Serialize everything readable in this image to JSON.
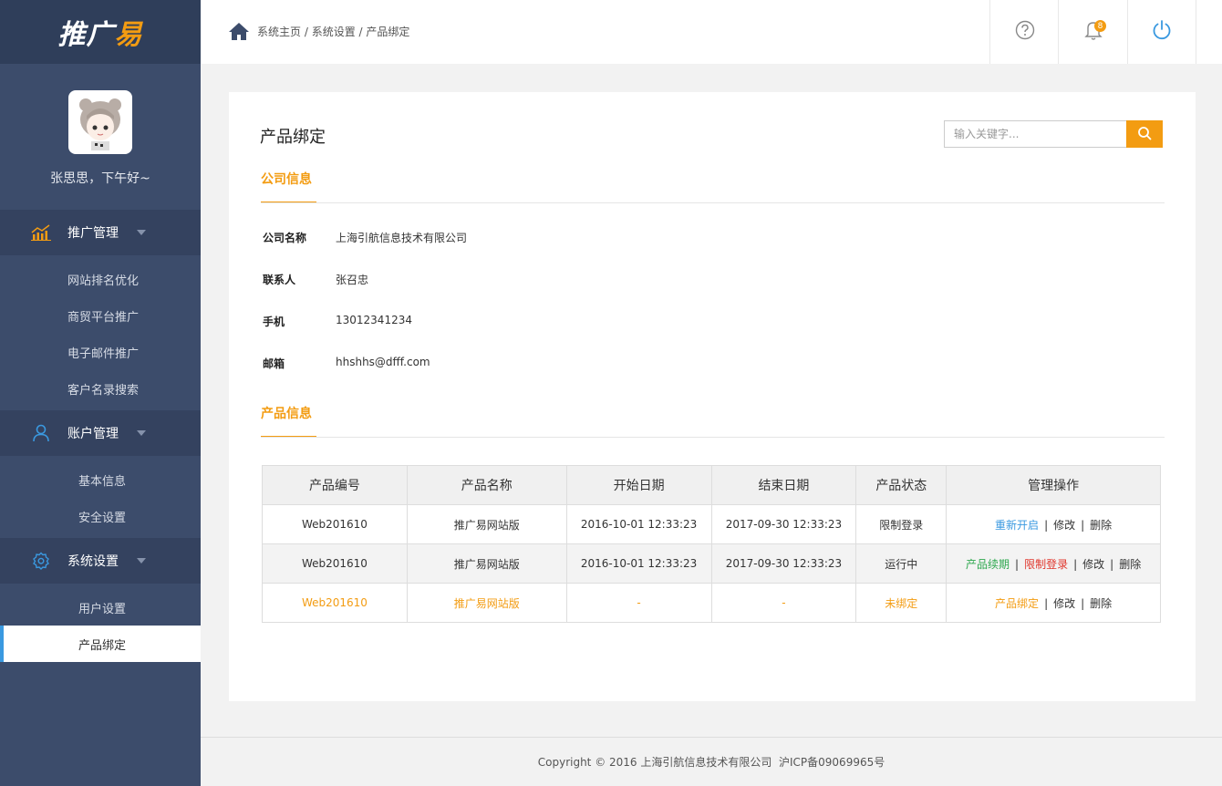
{
  "logo": {
    "text_main": "推广",
    "text_accent": "易"
  },
  "profile": {
    "greeting": "张思思，下午好~"
  },
  "menu": [
    {
      "label": "推广管理",
      "icon": "chart-icon",
      "items": [
        "网站排名优化",
        "商贸平台推广",
        "电子邮件推广",
        "客户名录搜索"
      ]
    },
    {
      "label": "账户管理",
      "icon": "user-icon",
      "items": [
        "基本信息",
        "安全设置"
      ]
    },
    {
      "label": "系统设置",
      "icon": "gear-icon",
      "items": [
        "用户设置",
        "产品绑定"
      ]
    }
  ],
  "breadcrumb": {
    "home": "系统主页",
    "sep1": " / ",
    "level2": "系统设置",
    "sep2": " / ",
    "current": "产品绑定"
  },
  "header": {
    "notification_count": "8"
  },
  "page": {
    "title": "产品绑定",
    "search_placeholder": "输入关键字..."
  },
  "company": {
    "tab": "公司信息",
    "fields": [
      {
        "label": "公司名称",
        "value": "上海引航信息技术有限公司"
      },
      {
        "label": "联系人",
        "value": "张召忠"
      },
      {
        "label": "手机",
        "value": "13012341234"
      },
      {
        "label": "邮箱",
        "value": "hhshhs@dfff.com"
      }
    ]
  },
  "products": {
    "tab": "产品信息",
    "headers": [
      "产品编号",
      "产品名称",
      "开始日期",
      "结束日期",
      "产品状态",
      "管理操作"
    ],
    "rows": [
      {
        "id": "Web201610",
        "name": "推广易网站版",
        "start": "2016-10-01 12:33:23",
        "end": "2017-09-30 12:33:23",
        "status": "限制登录",
        "ops": [
          "重新开启",
          "修改",
          "删除"
        ]
      },
      {
        "id": "Web201610",
        "name": "推广易网站版",
        "start": "2016-10-01 12:33:23",
        "end": "2017-09-30 12:33:23",
        "status": "运行中",
        "ops": [
          "产品续期",
          "限制登录",
          "修改",
          "删除"
        ]
      },
      {
        "id": "Web201610",
        "name": "推广易网站版",
        "start": "-",
        "end": "-",
        "status": "未绑定",
        "ops": [
          "产品绑定",
          "修改",
          "删除"
        ]
      }
    ],
    "separator": "|"
  },
  "footer": {
    "text": "Copyright © 2016 上海引航信息技术有限公司  沪ICP备09069965号"
  },
  "colors": {
    "accent": "#f39c12",
    "sidebar": "#3c4c6b",
    "link_blue": "#3a99e0",
    "green": "#2fa84f",
    "red": "#e0352b"
  }
}
